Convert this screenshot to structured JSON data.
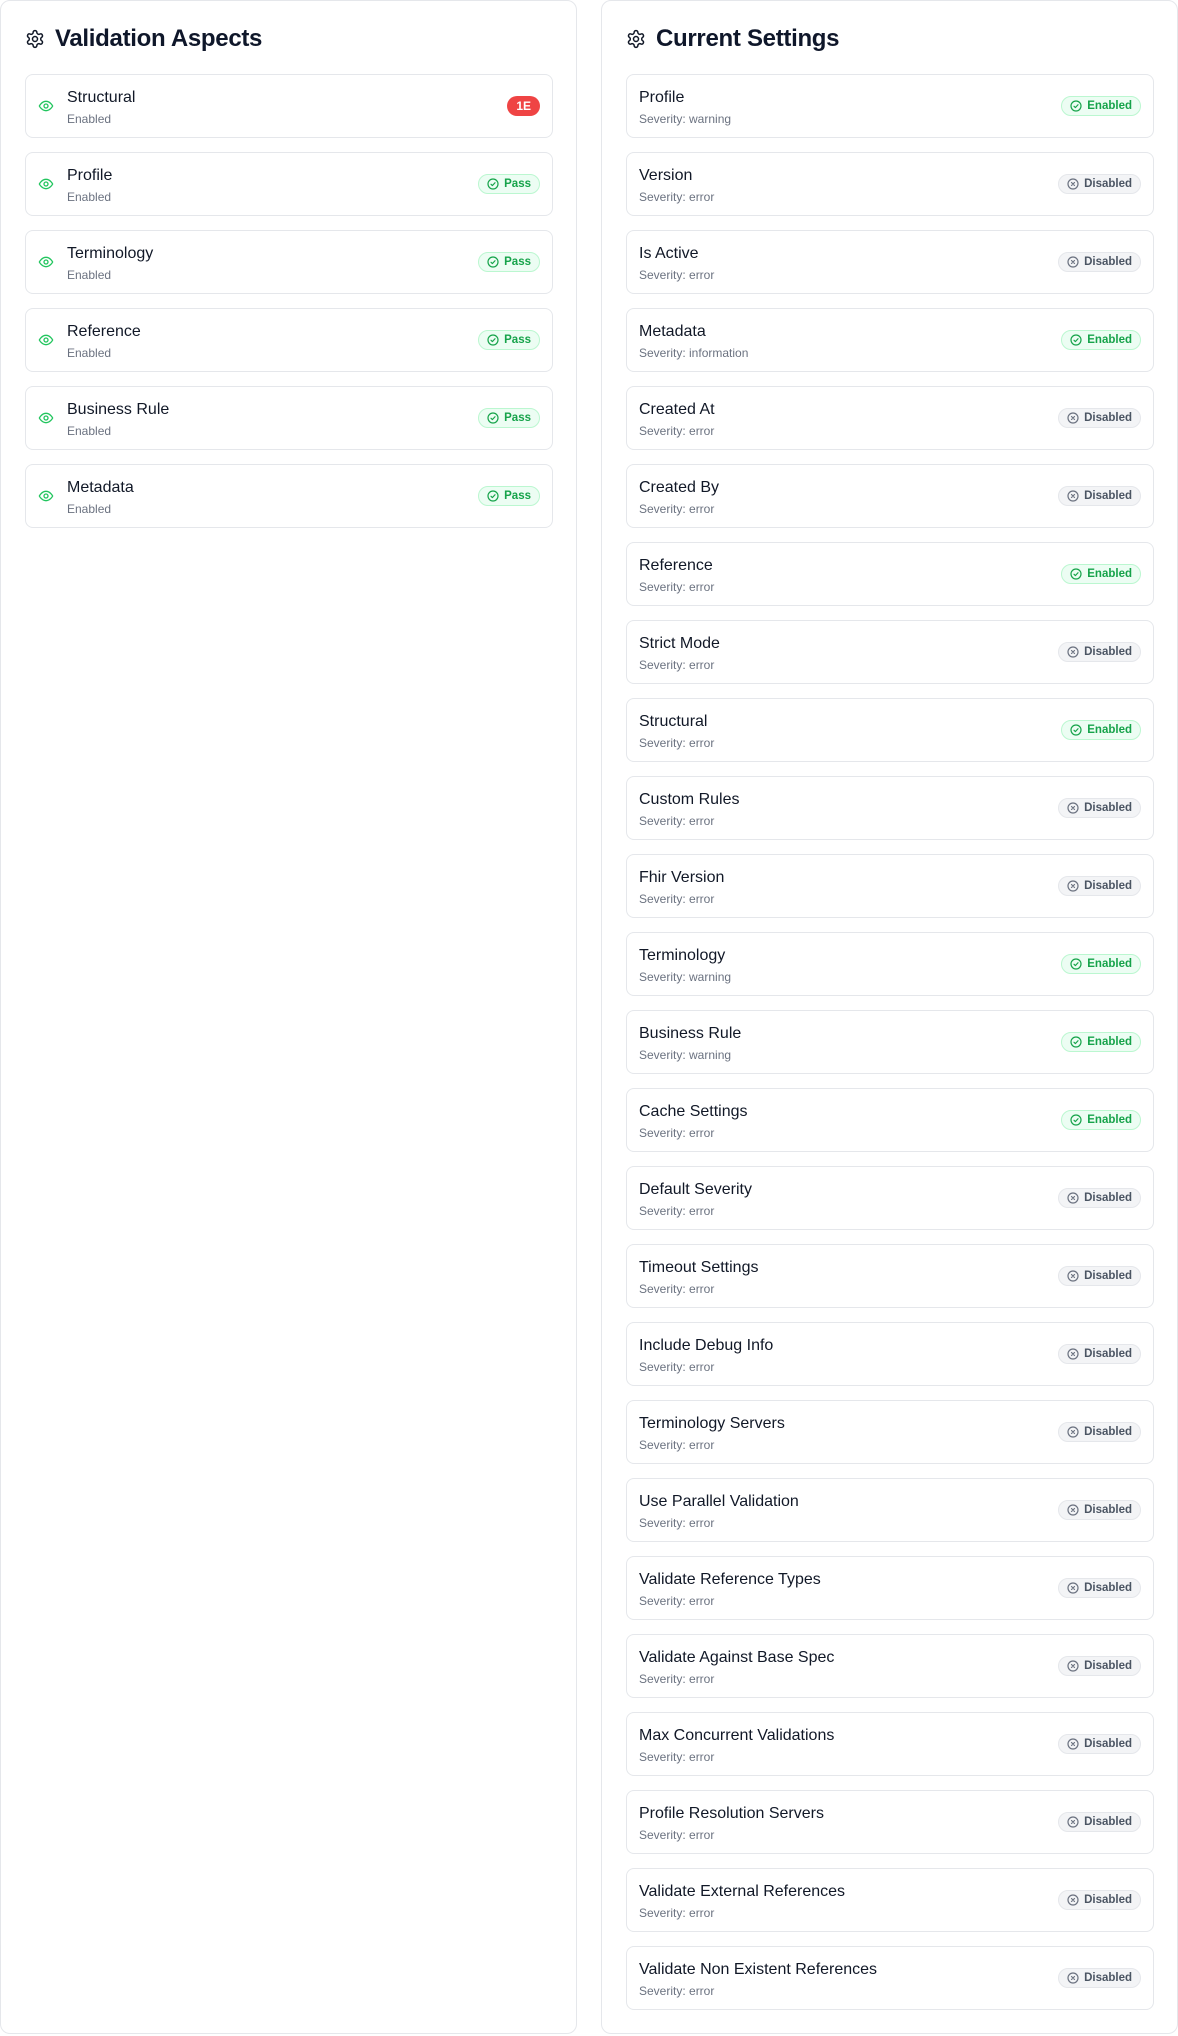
{
  "validation_aspects": {
    "title": "Validation Aspects",
    "header_icon": "gear-icon",
    "items": [
      {
        "name": "Structural",
        "status": "Enabled",
        "badge": "1E",
        "badge_type": "error",
        "icon": "eye-icon"
      },
      {
        "name": "Profile",
        "status": "Enabled",
        "badge": "Pass",
        "badge_type": "pass",
        "icon": "eye-icon"
      },
      {
        "name": "Terminology",
        "status": "Enabled",
        "badge": "Pass",
        "badge_type": "pass",
        "icon": "eye-icon"
      },
      {
        "name": "Reference",
        "status": "Enabled",
        "badge": "Pass",
        "badge_type": "pass",
        "icon": "eye-icon"
      },
      {
        "name": "Business Rule",
        "status": "Enabled",
        "badge": "Pass",
        "badge_type": "pass",
        "icon": "eye-icon"
      },
      {
        "name": "Metadata",
        "status": "Enabled",
        "badge": "Pass",
        "badge_type": "pass",
        "icon": "eye-icon"
      }
    ]
  },
  "current_settings": {
    "title": "Current Settings",
    "header_icon": "gear-icon",
    "items": [
      {
        "name": "Profile",
        "severity": "Severity: warning",
        "badge": "Enabled",
        "badge_type": "enabled"
      },
      {
        "name": "Version",
        "severity": "Severity: error",
        "badge": "Disabled",
        "badge_type": "disabled"
      },
      {
        "name": "Is Active",
        "severity": "Severity: error",
        "badge": "Disabled",
        "badge_type": "disabled"
      },
      {
        "name": "Metadata",
        "severity": "Severity: information",
        "badge": "Enabled",
        "badge_type": "enabled"
      },
      {
        "name": "Created At",
        "severity": "Severity: error",
        "badge": "Disabled",
        "badge_type": "disabled"
      },
      {
        "name": "Created By",
        "severity": "Severity: error",
        "badge": "Disabled",
        "badge_type": "disabled"
      },
      {
        "name": "Reference",
        "severity": "Severity: error",
        "badge": "Enabled",
        "badge_type": "enabled"
      },
      {
        "name": "Strict Mode",
        "severity": "Severity: error",
        "badge": "Disabled",
        "badge_type": "disabled"
      },
      {
        "name": "Structural",
        "severity": "Severity: error",
        "badge": "Enabled",
        "badge_type": "enabled"
      },
      {
        "name": "Custom Rules",
        "severity": "Severity: error",
        "badge": "Disabled",
        "badge_type": "disabled"
      },
      {
        "name": "Fhir Version",
        "severity": "Severity: error",
        "badge": "Disabled",
        "badge_type": "disabled"
      },
      {
        "name": "Terminology",
        "severity": "Severity: warning",
        "badge": "Enabled",
        "badge_type": "enabled"
      },
      {
        "name": "Business Rule",
        "severity": "Severity: warning",
        "badge": "Enabled",
        "badge_type": "enabled"
      },
      {
        "name": "Cache Settings",
        "severity": "Severity: error",
        "badge": "Enabled",
        "badge_type": "enabled"
      },
      {
        "name": "Default Severity",
        "severity": "Severity: error",
        "badge": "Disabled",
        "badge_type": "disabled"
      },
      {
        "name": "Timeout Settings",
        "severity": "Severity: error",
        "badge": "Disabled",
        "badge_type": "disabled"
      },
      {
        "name": "Include Debug Info",
        "severity": "Severity: error",
        "badge": "Disabled",
        "badge_type": "disabled"
      },
      {
        "name": "Terminology Servers",
        "severity": "Severity: error",
        "badge": "Disabled",
        "badge_type": "disabled"
      },
      {
        "name": "Use Parallel Validation",
        "severity": "Severity: error",
        "badge": "Disabled",
        "badge_type": "disabled"
      },
      {
        "name": "Validate Reference Types",
        "severity": "Severity: error",
        "badge": "Disabled",
        "badge_type": "disabled"
      },
      {
        "name": "Validate Against Base Spec",
        "severity": "Severity: error",
        "badge": "Disabled",
        "badge_type": "disabled"
      },
      {
        "name": "Max Concurrent Validations",
        "severity": "Severity: error",
        "badge": "Disabled",
        "badge_type": "disabled"
      },
      {
        "name": "Profile Resolution Servers",
        "severity": "Severity: error",
        "badge": "Disabled",
        "badge_type": "disabled"
      },
      {
        "name": "Validate External References",
        "severity": "Severity: error",
        "badge": "Disabled",
        "badge_type": "disabled"
      },
      {
        "name": "Validate Non Existent References",
        "severity": "Severity: error",
        "badge": "Disabled",
        "badge_type": "disabled"
      }
    ]
  },
  "colors": {
    "success": "#16a34a",
    "error": "#ef4444",
    "muted": "#6b7280",
    "border": "#e5e7eb"
  }
}
